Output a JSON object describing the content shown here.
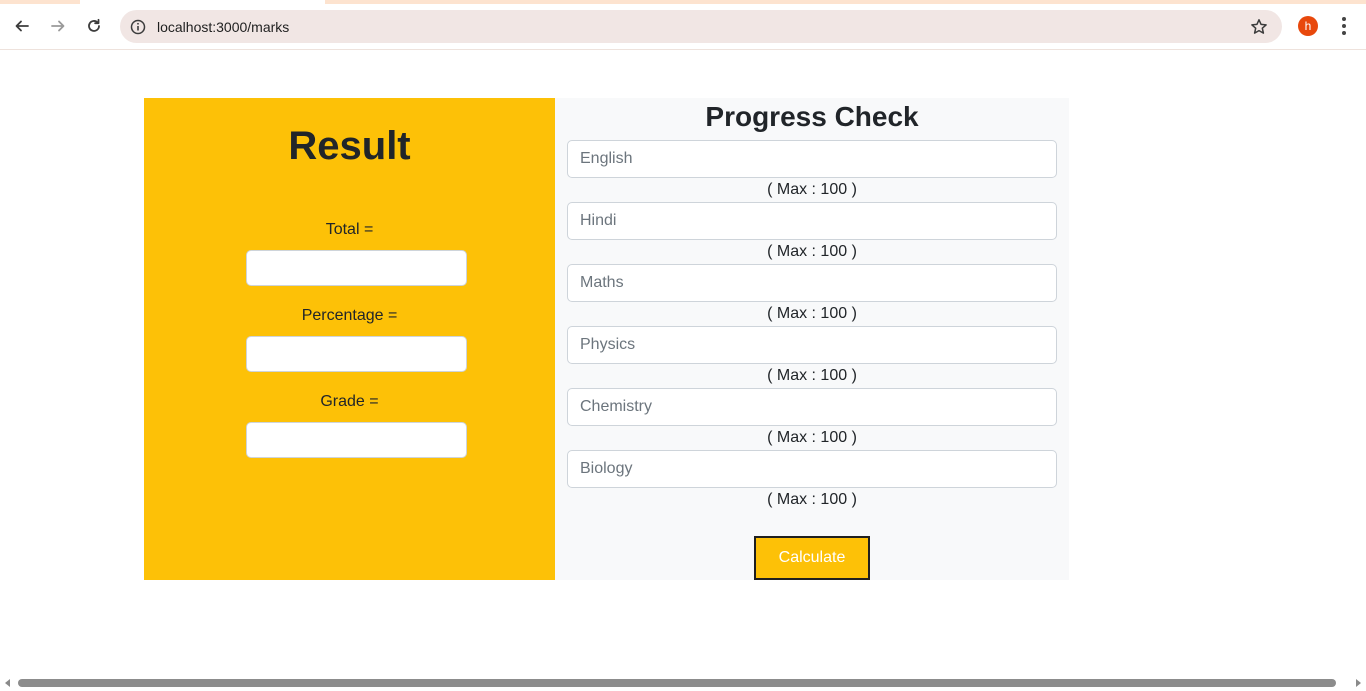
{
  "browser": {
    "url": "localhost:3000/marks",
    "profile_initial": "h",
    "colors": {
      "profile": "#e8480c",
      "omnibox": "#f1e6e4"
    }
  },
  "result_panel": {
    "title": "Result",
    "fields": [
      {
        "label": "Total =",
        "value": ""
      },
      {
        "label": "Percentage =",
        "value": ""
      },
      {
        "label": "Grade =",
        "value": ""
      }
    ],
    "background": "#fdc107"
  },
  "progress_panel": {
    "title": "Progress Check",
    "subjects": [
      {
        "placeholder": "English",
        "max_label": "( Max : 100 )"
      },
      {
        "placeholder": "Hindi",
        "max_label": "( Max : 100 )"
      },
      {
        "placeholder": "Maths",
        "max_label": "( Max : 100 )"
      },
      {
        "placeholder": "Physics",
        "max_label": "( Max : 100 )"
      },
      {
        "placeholder": "Chemistry",
        "max_label": "( Max : 100 )"
      },
      {
        "placeholder": "Biology",
        "max_label": "( Max : 100 )"
      }
    ],
    "calculate_label": "Calculate",
    "background": "#f8f9fa"
  },
  "icons": {
    "back": "arrow-left-icon",
    "forward": "arrow-right-icon",
    "reload": "reload-icon",
    "info": "info-icon",
    "bookmark": "star-icon",
    "menu": "kebab-menu-icon"
  }
}
